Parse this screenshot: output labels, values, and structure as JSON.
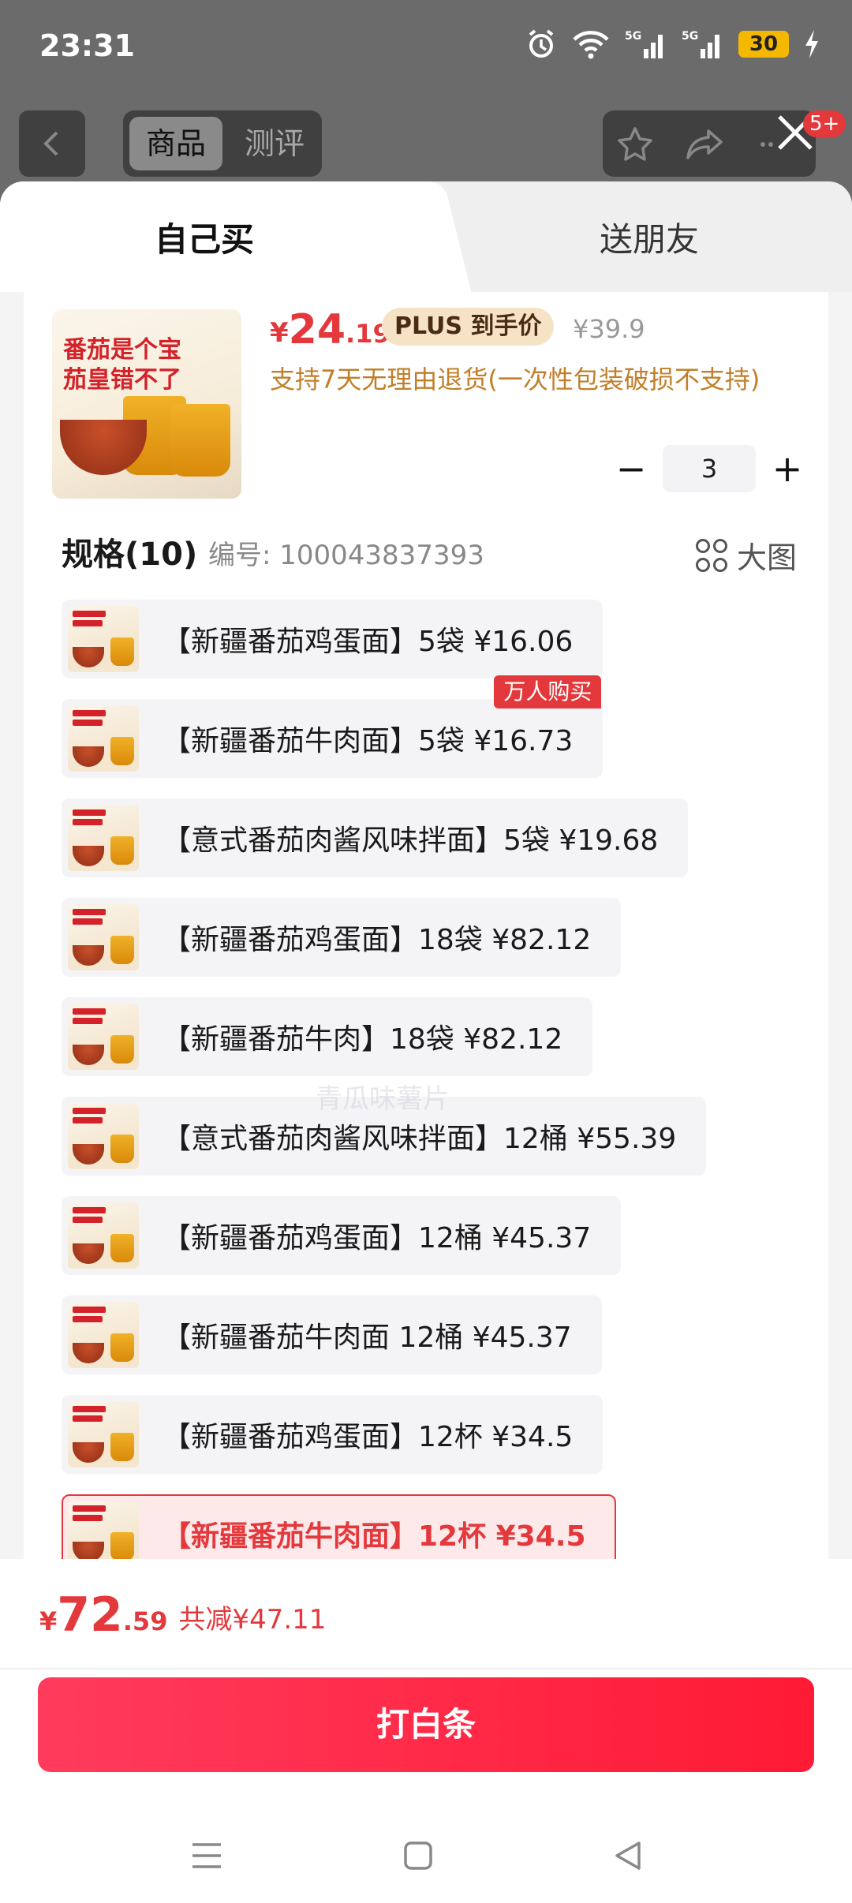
{
  "status_bar": {
    "time": "23:31",
    "battery": "30"
  },
  "header": {
    "segments": [
      "商品",
      "测评"
    ],
    "badge": "5+"
  },
  "tabs": {
    "self_buy": "自己买",
    "gift_friend": "送朋友"
  },
  "product": {
    "thumb_text_line1": "番茄是个宝",
    "thumb_text_line2": "茄皇错不了",
    "price_symbol": "¥",
    "price_int": "24",
    "price_dec": ".19",
    "plus_tag": "PLUS 到手价",
    "original_price": "¥39.9",
    "return_policy": "支持7天无理由退货(一次性包装破损不支持)"
  },
  "quantity": {
    "minus": "−",
    "value": "3",
    "plus": "+"
  },
  "spec": {
    "title": "规格(10)",
    "code": "编号: 100043837393",
    "big_picture": "大图",
    "items": [
      {
        "label": "【新疆番茄鸡蛋面】5袋  ¥16.06"
      },
      {
        "label": "【新疆番茄牛肉面】5袋  ¥16.73",
        "tag": "万人购买"
      },
      {
        "label": "【意式番茄肉酱风味拌面】5袋  ¥19.68"
      },
      {
        "label": "【新疆番茄鸡蛋面】18袋  ¥82.12"
      },
      {
        "label": "【新疆番茄牛肉】18袋  ¥82.12"
      },
      {
        "label": "【意式番茄肉酱风味拌面】12桶  ¥55.39"
      },
      {
        "label": "【新疆番茄鸡蛋面】12桶  ¥45.37"
      },
      {
        "label": "【新疆番茄牛肉面 12桶  ¥45.37"
      },
      {
        "label": "【新疆番茄鸡蛋面】12杯  ¥34.5"
      },
      {
        "label": "【新疆番茄牛肉面】12杯  ¥34.5",
        "selected": true
      }
    ]
  },
  "watermark": "青瓜味薯片",
  "footer": {
    "total_symbol": "¥",
    "total_int": "72",
    "total_dec": ".59",
    "discount": "共减¥47.11",
    "pay_button": "打白条"
  },
  "colors": {
    "accent": "#e4393c",
    "plus_bg": "#f6e3c6",
    "policy": "#c17f2a",
    "button": "#ff2a45"
  }
}
